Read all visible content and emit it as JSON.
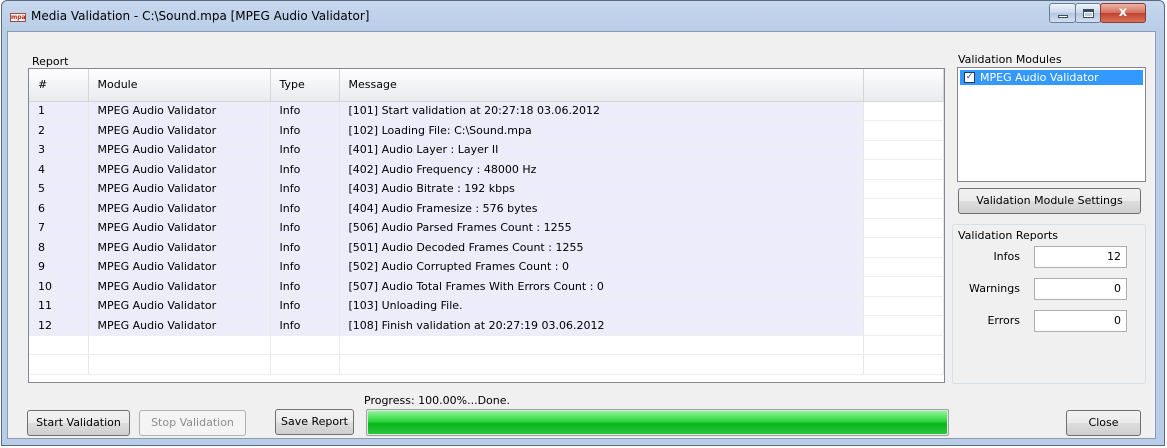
{
  "window": {
    "title": "Media Validation - C:\\Sound.mpa [MPEG Audio Validator]",
    "app_icon_text": "mpa",
    "close_glyph": "x"
  },
  "report": {
    "group_label": "Report",
    "columns": [
      "#",
      "Module",
      "Type",
      "Message"
    ],
    "rows": [
      {
        "num": "1",
        "module": "MPEG Audio Validator",
        "type": "Info",
        "message": "[101] Start validation at 20:27:18  03.06.2012"
      },
      {
        "num": "2",
        "module": "MPEG Audio Validator",
        "type": "Info",
        "message": "[102] Loading File: C:\\Sound.mpa"
      },
      {
        "num": "3",
        "module": "MPEG Audio Validator",
        "type": "Info",
        "message": "[401] Audio Layer : Layer II"
      },
      {
        "num": "4",
        "module": "MPEG Audio Validator",
        "type": "Info",
        "message": "[402] Audio Frequency : 48000 Hz"
      },
      {
        "num": "5",
        "module": "MPEG Audio Validator",
        "type": "Info",
        "message": "[403] Audio Bitrate : 192 kbps"
      },
      {
        "num": "6",
        "module": "MPEG Audio Validator",
        "type": "Info",
        "message": "[404] Audio Framesize : 576 bytes"
      },
      {
        "num": "7",
        "module": "MPEG Audio Validator",
        "type": "Info",
        "message": "[506] Audio Parsed Frames Count : 1255"
      },
      {
        "num": "8",
        "module": "MPEG Audio Validator",
        "type": "Info",
        "message": "[501] Audio Decoded Frames Count : 1255"
      },
      {
        "num": "9",
        "module": "MPEG Audio Validator",
        "type": "Info",
        "message": "[502] Audio Corrupted Frames Count : 0"
      },
      {
        "num": "10",
        "module": "MPEG Audio Validator",
        "type": "Info",
        "message": "[507] Audio Total Frames With Errors Count : 0"
      },
      {
        "num": "11",
        "module": "MPEG Audio Validator",
        "type": "Info",
        "message": "[103] Unloading File."
      },
      {
        "num": "12",
        "module": "MPEG Audio Validator",
        "type": "Info",
        "message": "[108] Finish validation at 20:27:19  03.06.2012"
      }
    ]
  },
  "modules": {
    "group_label": "Validation Modules",
    "items": [
      {
        "label": "MPEG Audio Validator",
        "checked": true
      }
    ],
    "settings_button": "Validation Module Settings"
  },
  "reports": {
    "group_label": "Validation Reports",
    "infos_label": "Infos",
    "infos_value": "12",
    "warnings_label": "Warnings",
    "warnings_value": "0",
    "errors_label": "Errors",
    "errors_value": "0"
  },
  "footer": {
    "start_button": "Start Validation",
    "stop_button": "Stop Validation",
    "save_button": "Save Report",
    "progress_label": "Progress: 100.00%...Done.",
    "progress_fraction": 1.0,
    "close_button": "Close"
  },
  "colors": {
    "selection": "#3399ff",
    "progress_green": "#09b51d",
    "row_fill": "#ececfa"
  }
}
